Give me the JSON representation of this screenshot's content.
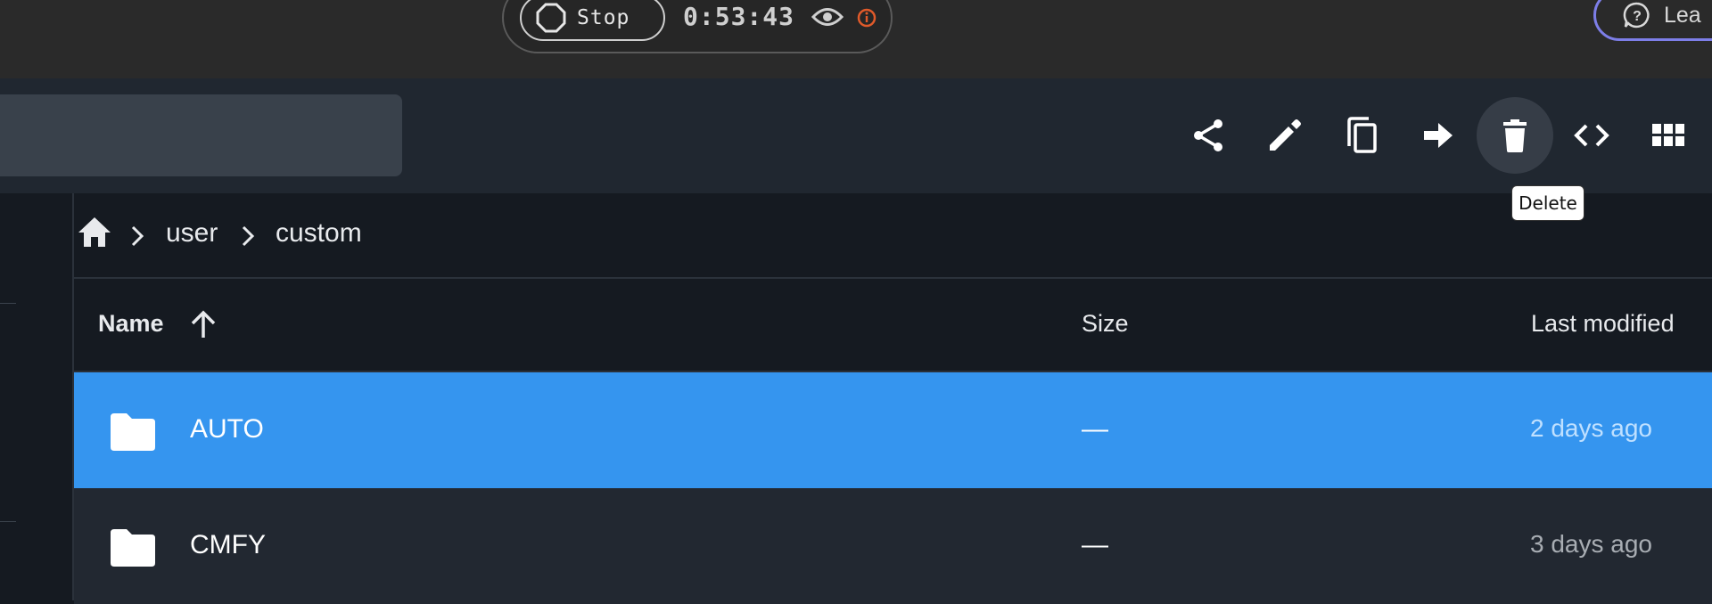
{
  "recorder": {
    "stop_label": "Stop",
    "timer": "0:53:43",
    "learn_label": "Lea"
  },
  "toolbar": {
    "search_placeholder": "",
    "tooltip": "Delete",
    "icons": [
      "share-icon",
      "edit-icon",
      "copy-icon",
      "move-icon",
      "delete-icon",
      "code-icon",
      "grid-view-icon"
    ]
  },
  "breadcrumb": {
    "items": [
      "user",
      "custom"
    ]
  },
  "table": {
    "headers": {
      "name": "Name",
      "size": "Size",
      "modified": "Last modified"
    },
    "rows": [
      {
        "name": "AUTO",
        "size": "—",
        "modified": "2 days ago",
        "selected": true
      },
      {
        "name": "CMFY",
        "size": "—",
        "modified": "3 days ago",
        "selected": false
      }
    ]
  },
  "colors": {
    "selected_row": "#3595ef",
    "toolbar_bg": "#202730",
    "page_bg": "#151a21",
    "warning": "#e05a2a",
    "learn_border": "#7d7ee8"
  }
}
